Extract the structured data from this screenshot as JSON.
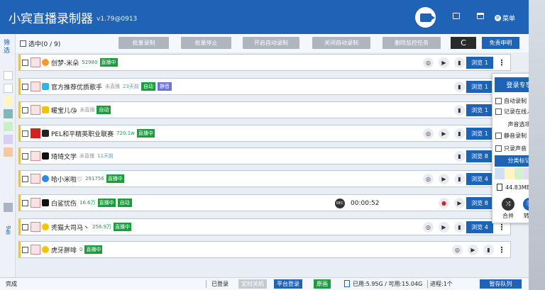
{
  "app": {
    "title": "小宾直播录制器",
    "version": "v1.79@0913",
    "menu_label": "菜单"
  },
  "sidebar": {
    "filter_label": "筛选",
    "count_label": "9条"
  },
  "toolbar": {
    "select_all_label": "选中(0 / 9)",
    "batch_record": "批量录制",
    "batch_stop": "批量停止",
    "enable_auto": "开启自动录制",
    "disable_auto": "关闭自动录制",
    "delete_tasks": "删除监控任务",
    "refresh_icon": "C",
    "disclaimer": "免责申明"
  },
  "rows": [
    {
      "name": "创梦-米朵",
      "meta": "52980",
      "live": "直播中",
      "auto": "",
      "mute": "",
      "browse": "浏览 1"
    },
    {
      "name": "官方推荐优质歌手",
      "meta": "未直播",
      "meta2": "23天前",
      "live": "",
      "auto": "自动",
      "mute": "静音",
      "browse": "浏览 1"
    },
    {
      "name": "暖宝儿😘",
      "meta": "未直播",
      "live": "",
      "auto": "自动",
      "mute": "",
      "browse": "浏览 1"
    },
    {
      "name": "PEL和平精英职业联赛",
      "meta": "720.1w",
      "live": "直播中",
      "auto": "",
      "mute": "",
      "browse": "浏览 1"
    },
    {
      "name": "琦琦文学",
      "meta": "未直播",
      "meta2": "11天前",
      "live": "",
      "auto": "",
      "mute": "",
      "browse": "浏览 8"
    },
    {
      "name": "哈小米啦♡",
      "meta": "291756",
      "live": "直播中",
      "auto": "",
      "mute": "",
      "browse": "浏览 4"
    },
    {
      "name": "白鲨忧伤",
      "meta": "16.6万",
      "live": "直播中",
      "auto": "自动",
      "mute": "",
      "browse": "浏览 8",
      "rec": "REC",
      "timer": "00:00:52"
    },
    {
      "name": "秃猫大司马丶",
      "meta": "256.9万",
      "live": "直播中",
      "auto": "",
      "mute": "",
      "browse": "浏览 4"
    },
    {
      "name": "虎牙胖啡",
      "meta": "0",
      "live": "直播中",
      "auto": "",
      "mute": "",
      "browse": ""
    }
  ],
  "dropdown": {
    "header": "登录专享",
    "auto_record": "自动录制",
    "record_online": "记录在线人数",
    "sound_section": "声音选项",
    "mute_record": "静音录制",
    "audio_only": "只录声音",
    "category_section": "分类标记",
    "size": "44.83MB",
    "merge": "合并",
    "convert": "转换",
    "colors": [
      "#cfe0f3",
      "#fff4c2",
      "#d5f0cf",
      "#e3dcf5",
      "#f8d8b8"
    ]
  },
  "status": {
    "left": "完成",
    "logged_in": "已登录",
    "shutdown": "定时关机",
    "platform_login": "平台登录",
    "original": "原画",
    "disk": "已用:5.95G / 可用:15.04G",
    "process": "进程:1个",
    "pause_queue": "暂存队列"
  }
}
